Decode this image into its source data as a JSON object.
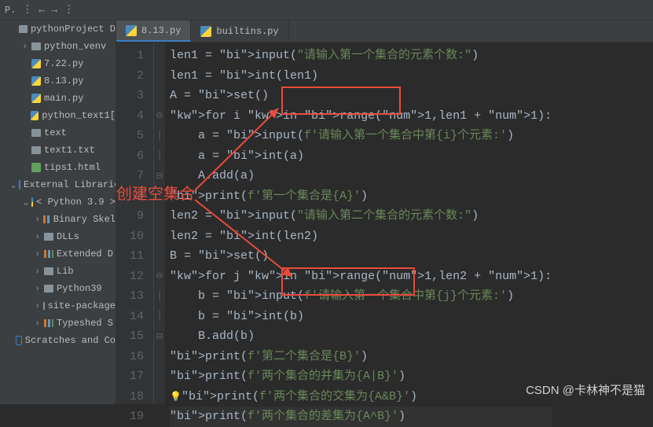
{
  "toolbar": {
    "label": "P."
  },
  "tabs": [
    {
      "label": "8.13.py",
      "active": true
    },
    {
      "label": "builtins.py",
      "active": false
    }
  ],
  "sidebar": {
    "items": [
      {
        "label": "pythonProject  D",
        "icon": "folder",
        "indent": 0,
        "chev": ""
      },
      {
        "label": "python_venv",
        "icon": "folder",
        "indent": 1,
        "chev": ">"
      },
      {
        "label": "7.22.py",
        "icon": "py",
        "indent": 1,
        "chev": ""
      },
      {
        "label": "8.13.py",
        "icon": "py",
        "indent": 1,
        "chev": ""
      },
      {
        "label": "main.py",
        "icon": "py",
        "indent": 1,
        "chev": ""
      },
      {
        "label": "python_text1[",
        "icon": "py",
        "indent": 1,
        "chev": ""
      },
      {
        "label": "text",
        "icon": "file",
        "indent": 1,
        "chev": ""
      },
      {
        "label": "text1.txt",
        "icon": "file",
        "indent": 1,
        "chev": ""
      },
      {
        "label": "tips1.html",
        "icon": "html",
        "indent": 1,
        "chev": ""
      },
      {
        "label": "External Libraries",
        "icon": "lib",
        "indent": 0,
        "chev": "v"
      },
      {
        "label": "< Python 3.9 >",
        "icon": "py",
        "indent": 1,
        "chev": "v"
      },
      {
        "label": "Binary Skel",
        "icon": "bar",
        "indent": 2,
        "chev": ">"
      },
      {
        "label": "DLLs",
        "icon": "folder",
        "indent": 2,
        "chev": ">"
      },
      {
        "label": "Extended D",
        "icon": "bar",
        "indent": 2,
        "chev": ">"
      },
      {
        "label": "Lib",
        "icon": "folder",
        "indent": 2,
        "chev": ">"
      },
      {
        "label": "Python39",
        "icon": "folder",
        "indent": 2,
        "chev": ">"
      },
      {
        "label": "site-package",
        "icon": "folder",
        "indent": 2,
        "chev": ">"
      },
      {
        "label": "Typeshed S",
        "icon": "bar",
        "indent": 2,
        "chev": ">"
      },
      {
        "label": "Scratches and Co",
        "icon": "scratch",
        "indent": 0,
        "chev": ""
      }
    ]
  },
  "code": {
    "start_line": 1,
    "lines": [
      "len1 = input(\"请输入第一个集合的元素个数:\")",
      "len1 = int(len1)",
      "A = set()",
      "for i in range(1,len1 + 1):",
      "    a = input(f'请输入第一个集合中第{i}个元素:')",
      "    a = int(a)",
      "    A.add(a)",
      "print(f'第一个集合是{A}')",
      "len2 = input(\"请输入第二个集合的元素个数:\")",
      "len2 = int(len2)",
      "B = set()",
      "for j in range(1,len2 + 1):",
      "    b = input(f'请输入第一个集合中第{j}个元素:')",
      "    b = int(b)",
      "    B.add(b)",
      "print(f'第二个集合是{B}')",
      "print(f'两个集合的并集为{A|B}')",
      "print(f'两个集合的交集为{A&B}')",
      "print(f'两个集合的差集为{A^B}')"
    ]
  },
  "annotation": {
    "text": "创建空集合"
  },
  "watermark": "CSDN @卡林神不是猫"
}
